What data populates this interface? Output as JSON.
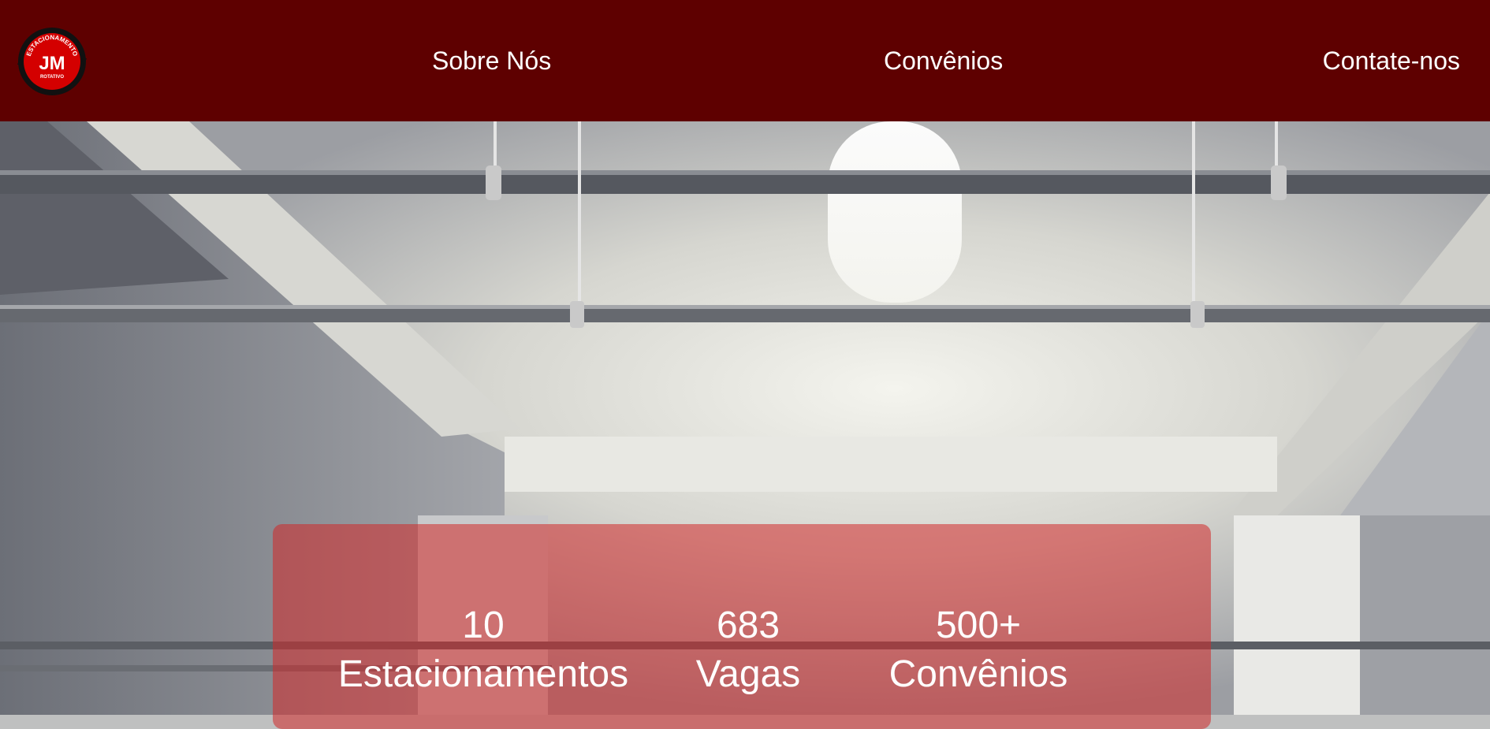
{
  "nav": {
    "logo": {
      "arc_text": "ESTACIONAMENTO",
      "initials": "JM",
      "subtitle": "ROTATIVO"
    },
    "links": [
      {
        "label": "Sobre Nós"
      },
      {
        "label": "Convênios"
      },
      {
        "label": "Contate-nos"
      }
    ]
  },
  "stats": [
    {
      "value": "10",
      "label": "Estacionamentos"
    },
    {
      "value": "683",
      "label": "Vagas"
    },
    {
      "value": "500+",
      "label": "Convênios"
    }
  ],
  "colors": {
    "nav_background": "#5e0000",
    "panel_overlay": "#d22828",
    "text": "#ffffff"
  }
}
